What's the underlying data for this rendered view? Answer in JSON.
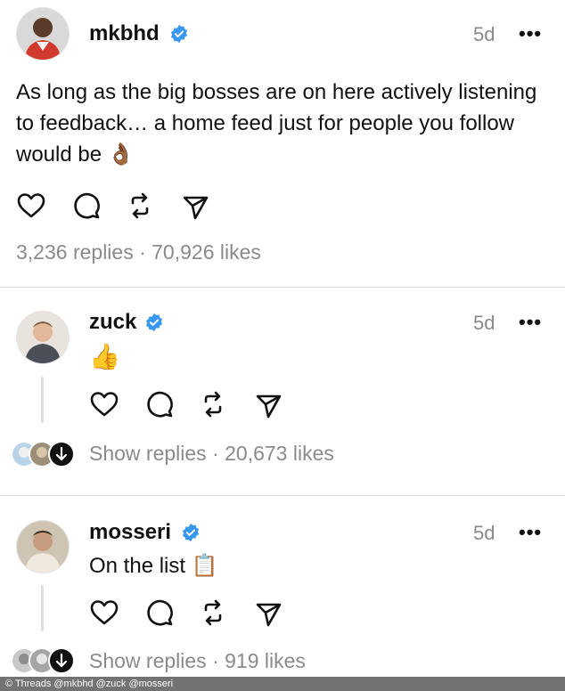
{
  "posts": [
    {
      "username": "mkbhd",
      "time": "5d",
      "more": "•••",
      "text": "As long as the big bosses are on here actively listening to feedback… a home feed just for people you follow would be 👌🏾",
      "stats": "3,236 replies · 70,926 likes"
    },
    {
      "username": "zuck",
      "time": "5d",
      "more": "•••",
      "text": "👍",
      "stats": "Show replies · 20,673 likes"
    },
    {
      "username": "mosseri",
      "time": "5d",
      "more": "•••",
      "text": "On the list 📋",
      "stats": "Show replies · 919 likes"
    }
  ],
  "icons": [
    "heart-icon",
    "comment-icon",
    "repost-icon",
    "share-icon",
    "verified-badge-icon",
    "more-icon"
  ],
  "colors": {
    "verified": "#3897f0",
    "muted": "#8a8a8a"
  },
  "footer": {
    "watermark": "© Threads @mkbhd @zuck @mosseri"
  }
}
